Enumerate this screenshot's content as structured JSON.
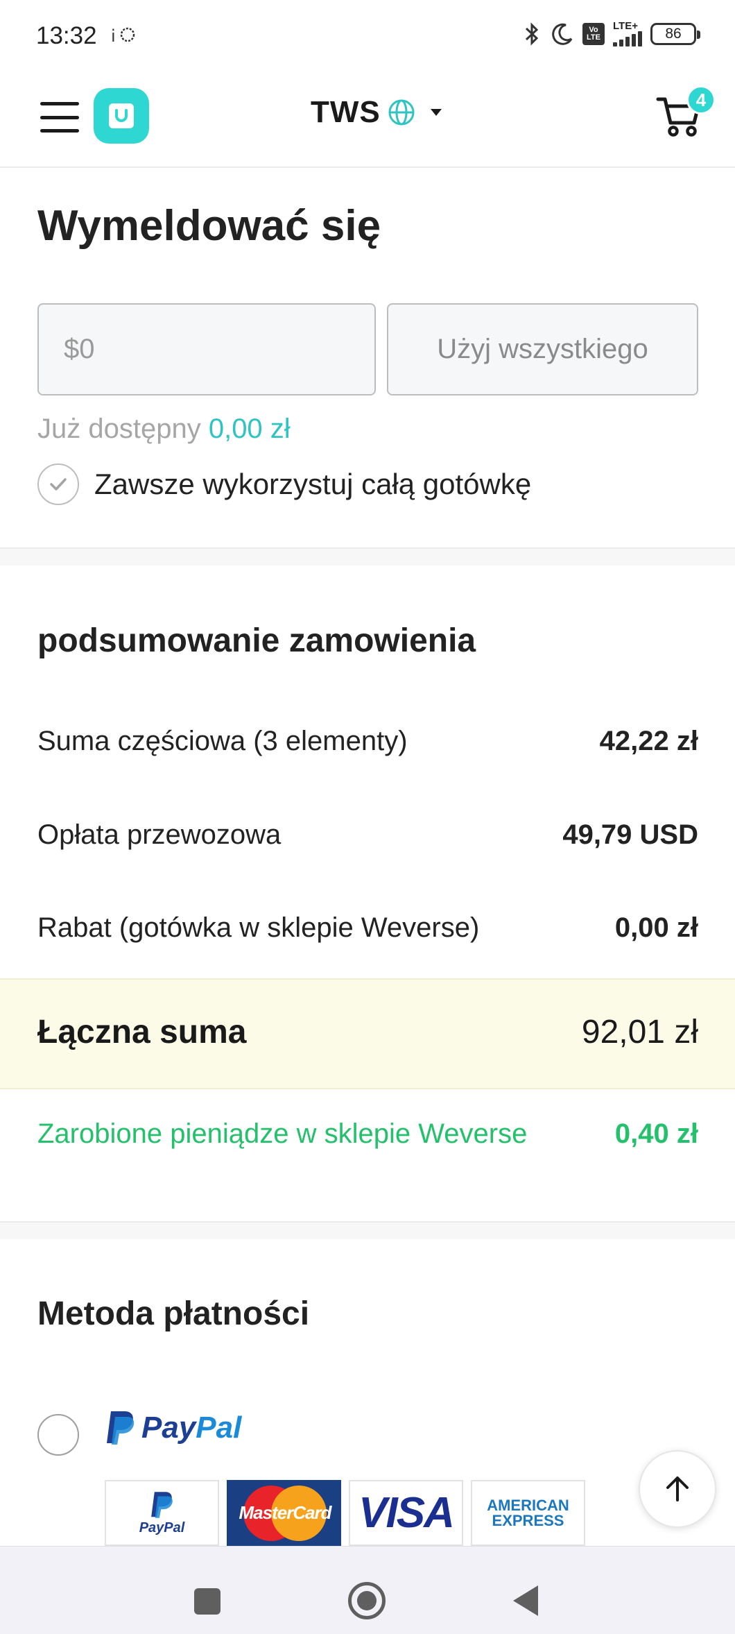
{
  "status_bar": {
    "time": "13:32",
    "battery": "86",
    "network": "LTE+",
    "volte": "Vo LTE"
  },
  "header": {
    "store_name": "TWS",
    "cart_count": "4"
  },
  "checkout": {
    "title": "Wymeldować się",
    "cash_placeholder": "$0",
    "use_all_label": "Użyj wszystkiego",
    "available_label": "Już dostępny",
    "available_amount": "0,00 zł",
    "always_use_label": "Zawsze wykorzystuj całą gotówkę"
  },
  "order_summary": {
    "title": "podsumowanie zamowienia",
    "rows": [
      {
        "label": "Suma częściowa (3 elementy)",
        "value": "42,22 zł"
      },
      {
        "label": "Opłata przewozowa",
        "value": "49,79 USD"
      },
      {
        "label": "Rabat (gotówka w sklepie Weverse)",
        "value": "0,00 zł"
      }
    ],
    "total_label": "Łączna suma",
    "total_value": "92,01 zł",
    "earned_label": "Zarobione pieniądze w sklepie Weverse",
    "earned_value": "0,40 zł"
  },
  "payment": {
    "title": "Metoda płatności",
    "option_label": "PayPal",
    "option_label_pay": "Pay",
    "option_label_pal": "Pal",
    "cards": [
      "PayPal",
      "MasterCard",
      "VISA",
      "AMERICAN EXPRESS"
    ]
  },
  "icons": {
    "menu": "hamburger-icon",
    "logo": "shop-bag-icon",
    "globe": "globe-icon",
    "dropdown": "caret-down-icon",
    "cart": "cart-icon",
    "check": "check-icon",
    "scroll_top": "arrow-up-icon"
  },
  "colors": {
    "accent": "#2fd7d2",
    "available_amount": "#2fc4c2",
    "earned": "#24c06b",
    "total_band": "#fcfbe8"
  }
}
